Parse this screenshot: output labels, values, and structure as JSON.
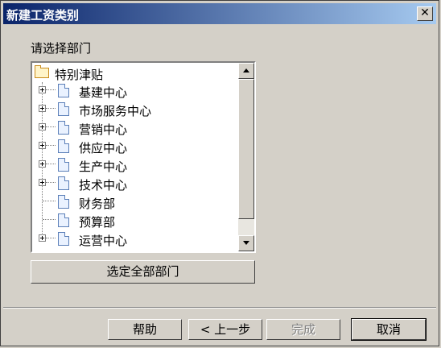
{
  "window": {
    "title": "新建工资类别",
    "close_glyph": "✕"
  },
  "prompt": "请选择部门",
  "tree": {
    "root": "特别津贴",
    "items": [
      {
        "label": "基建中心",
        "expandable": true
      },
      {
        "label": "市场服务中心",
        "expandable": true
      },
      {
        "label": "营销中心",
        "expandable": true
      },
      {
        "label": "供应中心",
        "expandable": true
      },
      {
        "label": "生产中心",
        "expandable": true
      },
      {
        "label": "技术中心",
        "expandable": true
      },
      {
        "label": "财务部",
        "expandable": false
      },
      {
        "label": "预算部",
        "expandable": false
      },
      {
        "label": "运营中心",
        "expandable": true
      }
    ]
  },
  "buttons": {
    "select_all": "选定全部部门",
    "help": "帮助",
    "back": "< 上一步",
    "finish": "完成",
    "cancel": "取消"
  },
  "colors": {
    "titlebar_start": "#0a246a",
    "titlebar_end": "#a6caf0",
    "face": "#d4d0c8"
  }
}
